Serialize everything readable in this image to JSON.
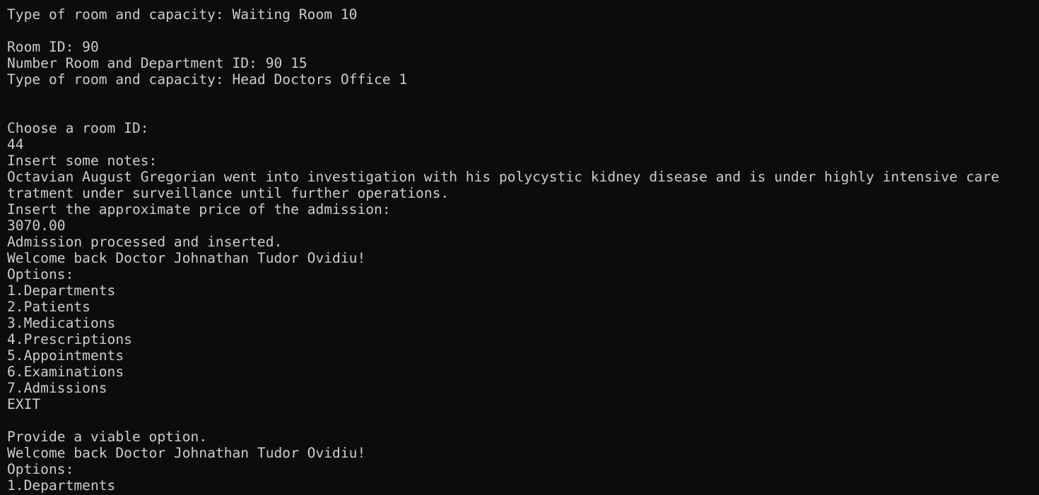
{
  "terminal": {
    "lines": [
      "Type of room and capacity: Waiting Room 10",
      "",
      "Room ID: 90",
      "Number Room and Department ID: 90 15",
      "Type of room and capacity: Head Doctors Office 1",
      "",
      "",
      "Choose a room ID:",
      "44",
      "Insert some notes:",
      "Octavian August Gregorian went into investigation with his polycystic kidney disease and is under highly intensive care",
      "tratment under surveillance until further operations.",
      "Insert the approximate price of the admission:",
      "3070.00",
      "Admission processed and inserted.",
      "Welcome back Doctor Johnathan Tudor Ovidiu!",
      "Options:",
      "1.Departments",
      "2.Patients",
      "3.Medications",
      "4.Prescriptions",
      "5.Appointments",
      "6.Examinations",
      "7.Admissions",
      "EXIT",
      "",
      "Provide a viable option.",
      "Welcome back Doctor Johnathan Tudor Ovidiu!",
      "Options:",
      "1.Departments"
    ]
  }
}
